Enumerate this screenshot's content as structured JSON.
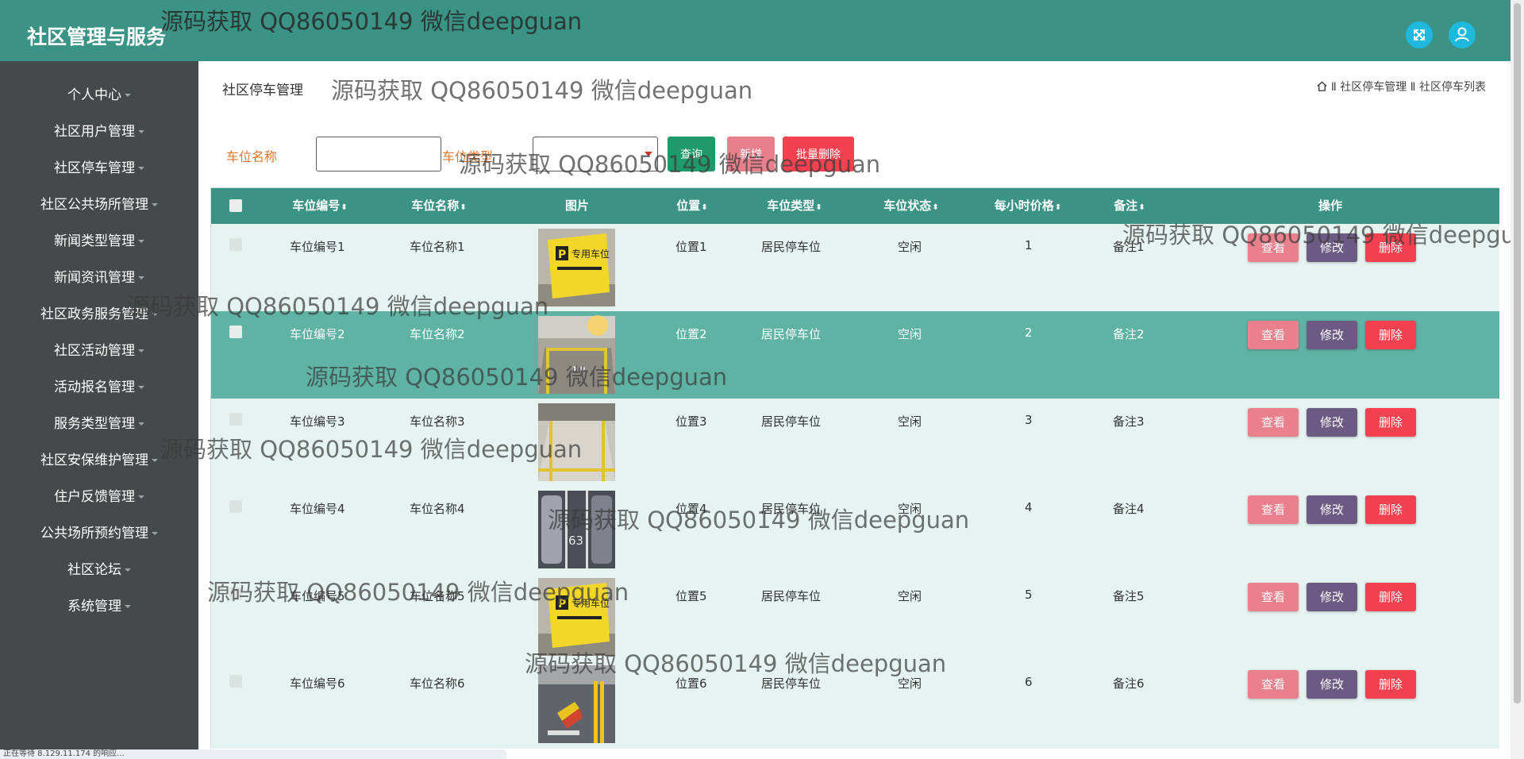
{
  "app": {
    "title": "社区管理与服务"
  },
  "watermark": "源码获取 QQ86050149 微信deepguan",
  "sidebar": {
    "items": [
      {
        "label": "个人中心"
      },
      {
        "label": "社区用户管理"
      },
      {
        "label": "社区停车管理"
      },
      {
        "label": "社区公共场所管理"
      },
      {
        "label": "新闻类型管理"
      },
      {
        "label": "新闻资讯管理"
      },
      {
        "label": "社区政务服务管理"
      },
      {
        "label": "社区活动管理"
      },
      {
        "label": "活动报名管理"
      },
      {
        "label": "服务类型管理"
      },
      {
        "label": "社区安保维护管理"
      },
      {
        "label": "住户反馈管理"
      },
      {
        "label": "公共场所预约管理"
      },
      {
        "label": "社区论坛"
      },
      {
        "label": "系统管理"
      }
    ]
  },
  "page": {
    "title": "社区停车管理",
    "breadcrumb": "Ⅱ 社区停车管理 Ⅱ 社区停车列表"
  },
  "search": {
    "name_label": "车位名称",
    "name_value": "",
    "type_label": "车位类型",
    "type_selected": "",
    "query_label": "查询",
    "add_label": "新增",
    "batch_delete_label": "批量删除"
  },
  "table": {
    "headers": {
      "code": "车位编号",
      "name": "车位名称",
      "image": "图片",
      "position": "位置",
      "type": "车位类型",
      "status": "车位状态",
      "price": "每小时价格",
      "note": "备注",
      "actions": "操作"
    },
    "rows": [
      {
        "code": "车位编号1",
        "name": "车位名称1",
        "position": "位置1",
        "type": "居民停车位",
        "status": "空闲",
        "price": "1",
        "note": "备注1"
      },
      {
        "code": "车位编号2",
        "name": "车位名称2",
        "position": "位置2",
        "type": "居民停车位",
        "status": "空闲",
        "price": "2",
        "note": "备注2"
      },
      {
        "code": "车位编号3",
        "name": "车位名称3",
        "position": "位置3",
        "type": "居民停车位",
        "status": "空闲",
        "price": "3",
        "note": "备注3"
      },
      {
        "code": "车位编号4",
        "name": "车位名称4",
        "position": "位置4",
        "type": "居民停车位",
        "status": "空闲",
        "price": "4",
        "note": "备注4"
      },
      {
        "code": "车位编号5",
        "name": "车位名称5",
        "position": "位置5",
        "type": "居民停车位",
        "status": "空闲",
        "price": "5",
        "note": "备注5"
      },
      {
        "code": "车位编号6",
        "name": "车位名称6",
        "position": "位置6",
        "type": "居民停车位",
        "status": "空闲",
        "price": "6",
        "note": "备注6"
      }
    ],
    "actions": {
      "view": "查看",
      "edit": "修改",
      "delete": "删除"
    }
  },
  "images": {
    "sign_text": "专用车位",
    "slot_number": "63"
  },
  "statusbar": {
    "text": "正在等待 8.129.11.174 的响应..."
  },
  "colors": {
    "header": "#3a9384",
    "sidebar": "#434a49",
    "row_light": "#e6f3f0",
    "row_highlight": "#5fb3a5",
    "view_button": "#e9808c",
    "edit_button": "#6b5a82",
    "delete_button": "#f4414f"
  }
}
